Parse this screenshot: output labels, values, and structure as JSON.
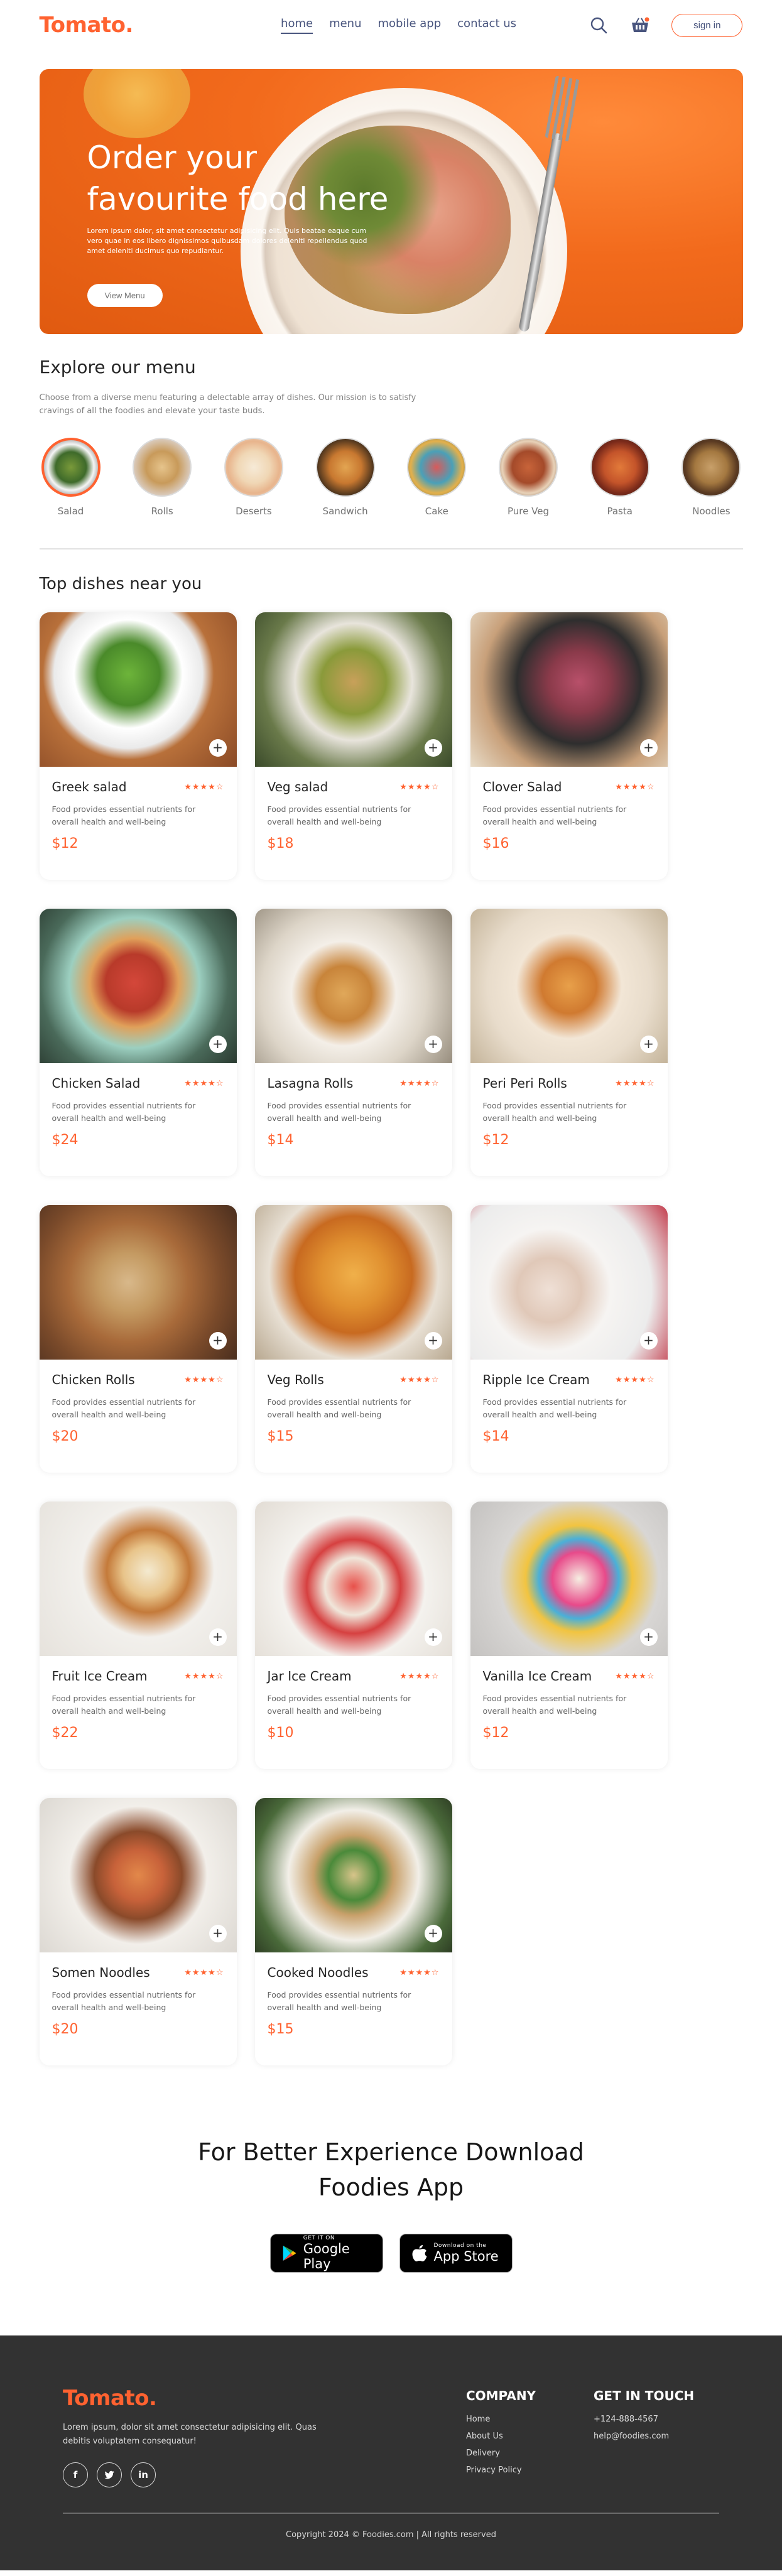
{
  "nav": {
    "logo": "Tomato.",
    "links": [
      "home",
      "menu",
      "mobile app",
      "contact us"
    ],
    "signin": "sign in",
    "search_icon": "search-icon",
    "basket_icon": "basket-icon"
  },
  "hero": {
    "title_line1": "Order your",
    "title_line2": "favourite food here",
    "body": "Lorem ipsum dolor, sit amet consectetur adipisicing elit. Quis beatae eaque cum vero quae in eos libero dignissimos quibusdam dolores deleniti repellendus quod amet deleniti ducimus quo repudiantur.",
    "button": "View Menu"
  },
  "explore": {
    "title": "Explore our menu",
    "desc": "Choose from a diverse menu featuring a delectable array of dishes. Our mission is to satisfy cravings of all the foodies and elevate your taste buds.",
    "items": [
      "Salad",
      "Rolls",
      "Deserts",
      "Sandwich",
      "Cake",
      "Pure Veg",
      "Pasta",
      "Noodles"
    ]
  },
  "dishes": {
    "title": "Top dishes near you",
    "desc": "Food provides essential nutrients for overall health and well-being",
    "stars": "★★★★☆",
    "add": "+",
    "items": [
      {
        "name": "Greek salad",
        "price": "$12"
      },
      {
        "name": "Veg salad",
        "price": "$18"
      },
      {
        "name": "Clover Salad",
        "price": "$16"
      },
      {
        "name": "Chicken Salad",
        "price": "$24"
      },
      {
        "name": "Lasagna Rolls",
        "price": "$14"
      },
      {
        "name": "Peri Peri Rolls",
        "price": "$12"
      },
      {
        "name": "Chicken Rolls",
        "price": "$20"
      },
      {
        "name": "Veg Rolls",
        "price": "$15"
      },
      {
        "name": "Ripple Ice Cream",
        "price": "$14"
      },
      {
        "name": "Fruit Ice Cream",
        "price": "$22"
      },
      {
        "name": "Jar Ice Cream",
        "price": "$10"
      },
      {
        "name": "Vanilla Ice Cream",
        "price": "$12"
      },
      {
        "name": "Somen Noodles",
        "price": "$20"
      },
      {
        "name": "Cooked Noodles",
        "price": "$15"
      }
    ]
  },
  "app": {
    "title_line1": "For Better Experience Download",
    "title_line2": "Foodies App",
    "google_small": "GET IT ON",
    "google_big": "Google Play",
    "apple_small": "Download on the",
    "apple_big": "App Store"
  },
  "footer": {
    "logo": "Tomato.",
    "text": "Lorem ipsum, dolor sit amet consectetur adipisicing elit. Quas debitis voluptatem consequatur!",
    "social_icons": [
      "facebook-icon",
      "twitter-icon",
      "linkedin-icon"
    ],
    "company_title": "COMPANY",
    "company_links": [
      "Home",
      "About Us",
      "Delivery",
      "Privacy Policy"
    ],
    "contact_title": "GET IN TOUCH",
    "phone": "+124-888-4567",
    "email": "help@foodies.com",
    "copyright": "Copyright 2024 © Foodies.com | All rights reserved"
  },
  "colors": {
    "accent": "#ff6230",
    "nav_text": "#49557e",
    "footer_bg": "#323232"
  }
}
